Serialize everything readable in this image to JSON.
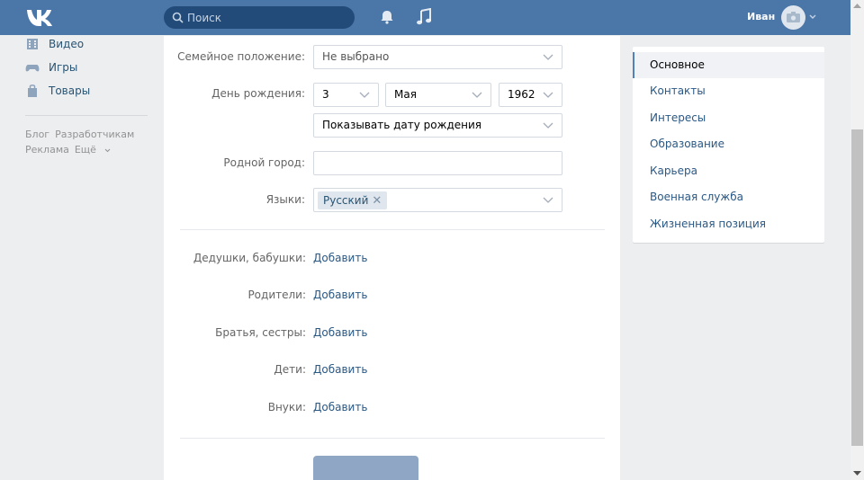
{
  "header": {
    "search_placeholder": "Поиск",
    "user_name": "Иван"
  },
  "leftnav": {
    "items": [
      {
        "label": "Видео",
        "icon": "video-icon"
      },
      {
        "label": "Игры",
        "icon": "gamepad-icon"
      },
      {
        "label": "Товары",
        "icon": "bag-icon"
      }
    ],
    "footer": [
      "Блог",
      "Разработчикам",
      "Реклама",
      "Ещё"
    ]
  },
  "form": {
    "marital_label": "Семейное положение:",
    "marital_value": "Не выбрано",
    "birthday_label": "День рождения:",
    "birth_day": "3",
    "birth_month": "Мая",
    "birth_year": "1962",
    "birthday_visibility": "Показывать дату рождения",
    "hometown_label": "Родной город:",
    "hometown_value": "",
    "languages_label": "Языки:",
    "language_tag": "Русский"
  },
  "relatives": [
    {
      "label": "Дедушки, бабушки:",
      "action": "Добавить"
    },
    {
      "label": "Родители:",
      "action": "Добавить"
    },
    {
      "label": "Братья, сестры:",
      "action": "Добавить"
    },
    {
      "label": "Дети:",
      "action": "Добавить"
    },
    {
      "label": "Внуки:",
      "action": "Добавить"
    }
  ],
  "right_menu": {
    "items": [
      "Основное",
      "Контакты",
      "Интересы",
      "Образование",
      "Карьера",
      "Военная служба",
      "Жизненная позиция"
    ],
    "active": "Основное"
  },
  "colors": {
    "header": "#4a76a8",
    "link": "#2a5885",
    "background": "#edeef0",
    "button": "#8fa7c4"
  }
}
